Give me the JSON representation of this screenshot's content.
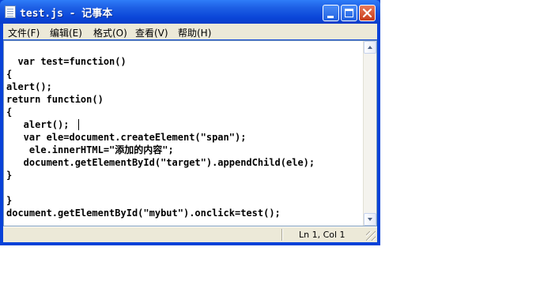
{
  "window": {
    "title": "test.js - 记事本"
  },
  "menu": [
    {
      "label": "文件(F)"
    },
    {
      "label": "编辑(E)"
    },
    {
      "label": "格式(O)"
    },
    {
      "label": "查看(V)"
    },
    {
      "label": "帮助(H)"
    }
  ],
  "editor": {
    "lines": [
      "  var test=function()",
      "{",
      "alert();",
      "return function()",
      "{",
      "   alert();",
      "   var ele=document.createElement(\"span\");",
      "    ele.innerHTML=\"添加的内容\";",
      "   document.getElementById(\"target\").appendChild(ele);",
      "}",
      "",
      "}",
      "document.getElementById(\"mybut\").onclick=test();"
    ]
  },
  "status": {
    "position": "Ln 1, Col 1"
  },
  "icons": {
    "app": "notepad-icon",
    "minimize": "minimize-icon",
    "maximize": "maximize-icon",
    "close": "close-icon"
  }
}
